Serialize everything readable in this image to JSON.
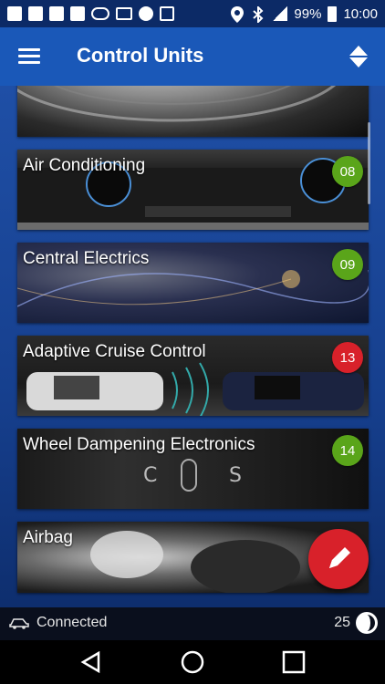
{
  "status_bar": {
    "battery_percent": "99%",
    "time": "10:00",
    "left_icons": [
      "message-icon",
      "facebook-icon",
      "facebook-icon",
      "facebook-icon",
      "voicemail-icon",
      "gmail-icon",
      "phone-icon",
      "image-icon"
    ],
    "right_icons": [
      "location-icon",
      "bluetooth-icon",
      "signal-icon",
      "battery-icon"
    ]
  },
  "app_bar": {
    "title": "Control Units",
    "menu_icon": "hamburger-menu-icon",
    "sort_icon": "sort-icon"
  },
  "list": {
    "items": [
      {
        "label": "",
        "badge": "",
        "badge_color": "#5aa51a",
        "art": "brake"
      },
      {
        "label": "Air Conditioning",
        "badge": "08",
        "badge_color": "#5aa51a",
        "art": "ac"
      },
      {
        "label": "Central Electrics",
        "badge": "09",
        "badge_color": "#5aa51a",
        "art": "central"
      },
      {
        "label": "Adaptive Cruise Control",
        "badge": "13",
        "badge_color": "#d8212a",
        "art": "acc"
      },
      {
        "label": "Wheel Dampening Electronics",
        "badge": "14",
        "badge_color": "#5aa51a",
        "art": "wheel"
      },
      {
        "label": "Airbag",
        "badge": "",
        "badge_color": "#5aa51a",
        "art": "airbag"
      }
    ]
  },
  "fab": {
    "icon": "pencil-icon",
    "color": "#d8212a"
  },
  "bottom_status": {
    "connection_label": "Connected",
    "count": "25",
    "connection_icon": "car-icon",
    "globe_icon": "globe-icon"
  },
  "nav_bar": {
    "icons": [
      "back-icon",
      "home-icon",
      "recents-icon"
    ]
  }
}
